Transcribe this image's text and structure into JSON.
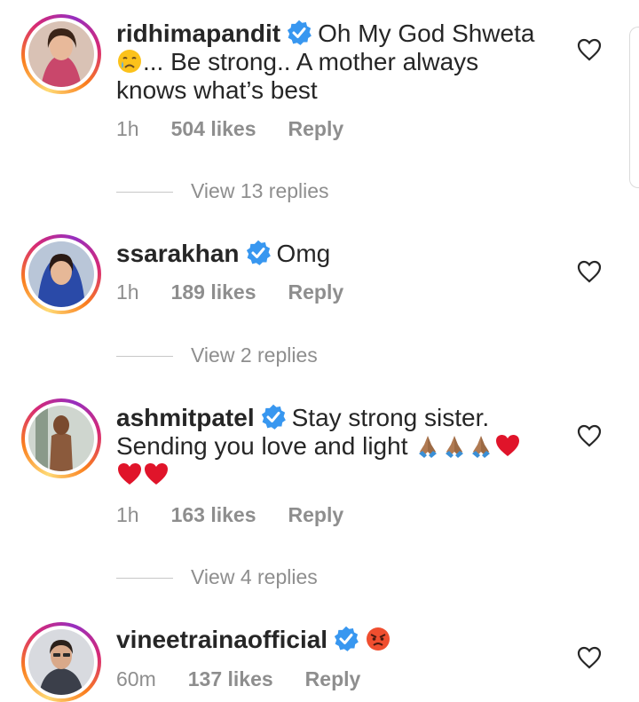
{
  "comments": [
    {
      "username": "ridhimapandit",
      "text_before_emoji": "Oh My God Shweta",
      "emoji": "crying-face",
      "text_after_emoji": "... Be strong.. A mother always knows what’s best",
      "time": "1h",
      "likes": "504 likes",
      "reply_label": "Reply",
      "view_replies": "View 13 replies"
    },
    {
      "username": "ssarakhan",
      "text": "Omg",
      "time": "1h",
      "likes": "189 likes",
      "reply_label": "Reply",
      "view_replies": "View 2 replies"
    },
    {
      "username": "ashmitpatel",
      "text": "Stay strong sister. Sending you love and light",
      "emojis": [
        "folded-hands",
        "folded-hands",
        "folded-hands",
        "red-heart",
        "red-heart",
        "red-heart"
      ],
      "time": "1h",
      "likes": "163 likes",
      "reply_label": "Reply",
      "view_replies": "View 4 replies"
    },
    {
      "username": "vineetrainaofficial",
      "emoji": "angry-face",
      "time": "60m",
      "likes": "137 likes",
      "reply_label": "Reply"
    }
  ],
  "colors": {
    "text": "#262626",
    "muted": "#8e8e8e",
    "verified": "#3897f0",
    "heart_emoji": "#e0142a"
  }
}
